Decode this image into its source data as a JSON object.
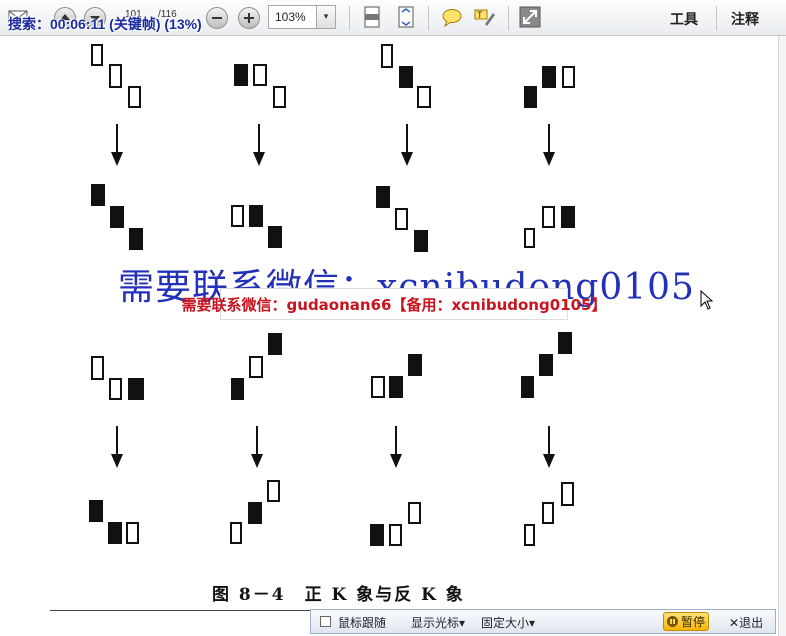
{
  "toolbar": {
    "page_current": "101",
    "page_total": "/116",
    "zoom": "103%",
    "tools_label": "工具",
    "comment_label": "注释"
  },
  "overlay": {
    "status": "搜索：00:06:11 (关键帧) (13%)"
  },
  "document": {
    "watermark_large": "需要联系微信：xcnibudong0105",
    "watermark_red": "需要联系微信：gudaonan66【备用：xcnibudong0105】",
    "caption": "图 8－4　正 K 象与反 K 象"
  },
  "bottom_bar": {
    "mouse_follow": "鼠标跟随",
    "show_cursor": "显示光标",
    "fixed_size": "固定大小",
    "pause": "暂停",
    "exit": "退出"
  },
  "icons": {
    "chevron": "▾",
    "close": "✕"
  }
}
